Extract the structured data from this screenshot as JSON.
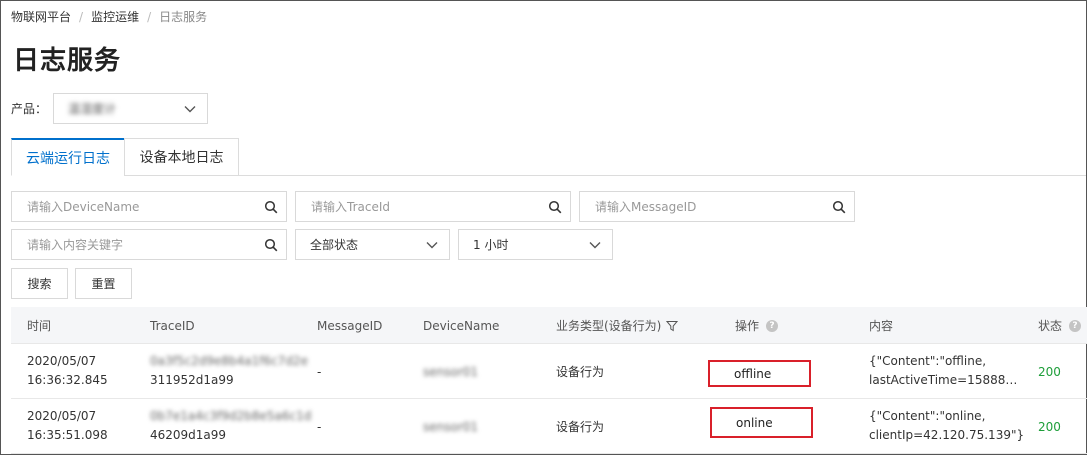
{
  "breadcrumb": {
    "items": [
      "物联网平台",
      "监控运维",
      "日志服务"
    ],
    "separator": "/"
  },
  "page": {
    "title": "日志服务"
  },
  "product": {
    "label": "产品：",
    "value": "温湿度计"
  },
  "tabs": [
    {
      "label": "云端运行日志",
      "active": true
    },
    {
      "label": "设备本地日志",
      "active": false
    }
  ],
  "filters": {
    "device_name_placeholder": "请输入DeviceName",
    "trace_id_placeholder": "请输入TraceId",
    "message_id_placeholder": "请输入MessageID",
    "keyword_placeholder": "请输入内容关键字",
    "status_select": "全部状态",
    "time_select": "1 小时"
  },
  "buttons": {
    "search": "搜索",
    "reset": "重置"
  },
  "table": {
    "headers": {
      "time": "时间",
      "trace_id": "TraceID",
      "message_id": "MessageID",
      "device_name": "DeviceName",
      "biz_type": "业务类型(设备行为)",
      "operation": "操作",
      "content": "内容",
      "status": "状态"
    },
    "rows": [
      {
        "date": "2020/05/07",
        "time": "16:36:32.845",
        "trace_line1": "0a3f5c2d9e8b4a1f6c7d2e",
        "trace_line2": "311952d1a99",
        "message_id": "-",
        "device_name": "sensor01",
        "biz_type": "设备行为",
        "operation": "offline",
        "content_line1": "{\"Content\":\"offline,",
        "content_line2": "lastActiveTime=15888…",
        "status": "200"
      },
      {
        "date": "2020/05/07",
        "time": "16:35:51.098",
        "trace_line1": "0b7e1a4c3f9d2b8e5a6c1d",
        "trace_line2": "46209d1a99",
        "message_id": "-",
        "device_name": "sensor01",
        "biz_type": "设备行为",
        "operation": "online",
        "content_line1": "{\"Content\":\"online,",
        "content_line2": "clientIp=42.120.75.139\"}",
        "status": "200"
      }
    ]
  },
  "colors": {
    "accent": "#0070cc",
    "highlight_border": "#d9202a",
    "status_ok": "#1e9e3a"
  },
  "icons": {
    "search": "search-icon",
    "chevron": "chevron-down-icon",
    "filter": "filter-icon",
    "help": "question-circle-icon"
  }
}
